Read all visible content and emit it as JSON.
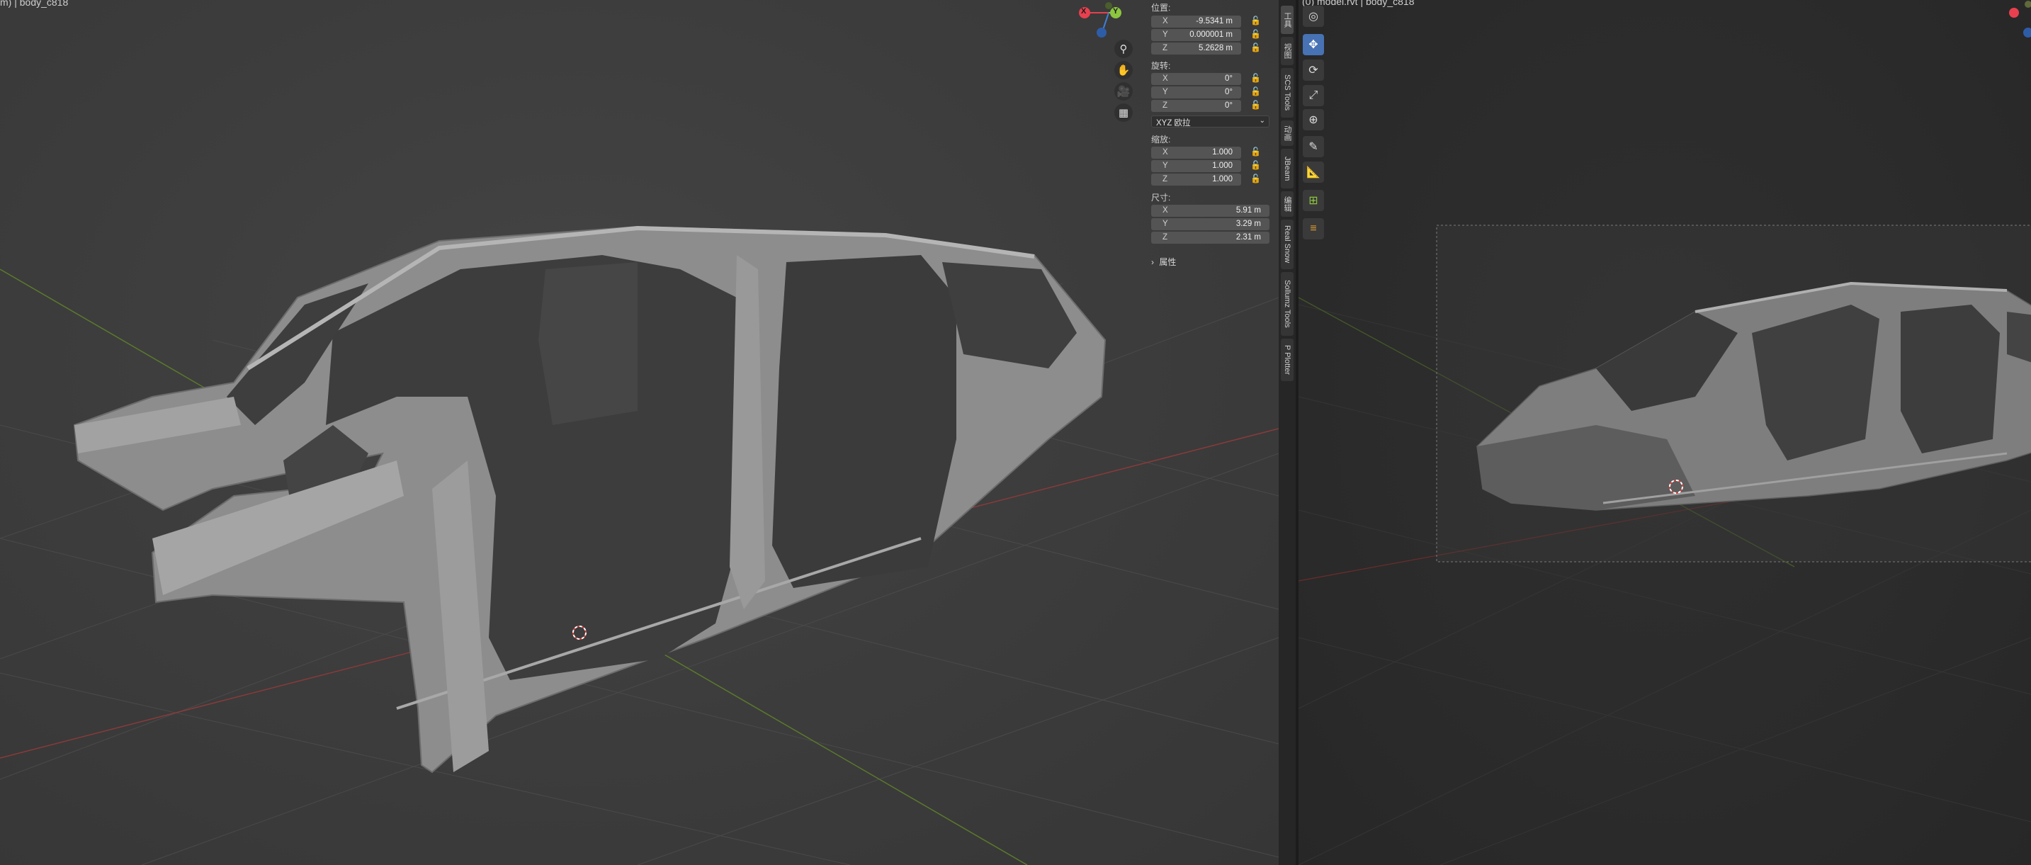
{
  "left_viewport": {
    "title": "m) | body_c818"
  },
  "nav_gizmo": {
    "x_label": "X",
    "y_label": "Y"
  },
  "n_panel": {
    "location": {
      "label": "位置:",
      "x": "-9.5341 m",
      "y": "0.000001 m",
      "z": "5.2628 m"
    },
    "rotation": {
      "label": "旋转:",
      "x": "0°",
      "y": "0°",
      "z": "0°",
      "mode": "XYZ 欧拉"
    },
    "scale": {
      "label": "缩放:",
      "x": "1.000",
      "y": "1.000",
      "z": "1.000"
    },
    "dimensions": {
      "label": "尺寸:",
      "x": "5.91 m",
      "y": "3.29 m",
      "z": "2.31 m"
    },
    "properties_label": "属性",
    "axis_labels": {
      "x": "X",
      "y": "Y",
      "z": "Z"
    }
  },
  "side_tabs": [
    "工具",
    "视图",
    "SCS Tools",
    "动画",
    "JBeam",
    "编辑",
    "Real Snow",
    "Sollumz Tools",
    "P Plotter"
  ],
  "right_viewport": {
    "title": "(0) model.rvt | body_c818",
    "tools": [
      "cursor-icon",
      "move-icon",
      "rotate-icon",
      "scale-icon",
      "transform-icon",
      "annotate-icon",
      "measure-icon",
      "add-cube-icon",
      "ruler-icon"
    ]
  },
  "colors": {
    "active_tool": "#4772b3",
    "axis_x": "#e8404f",
    "axis_y": "#8dc63f",
    "axis_z": "#3f7fd8"
  }
}
